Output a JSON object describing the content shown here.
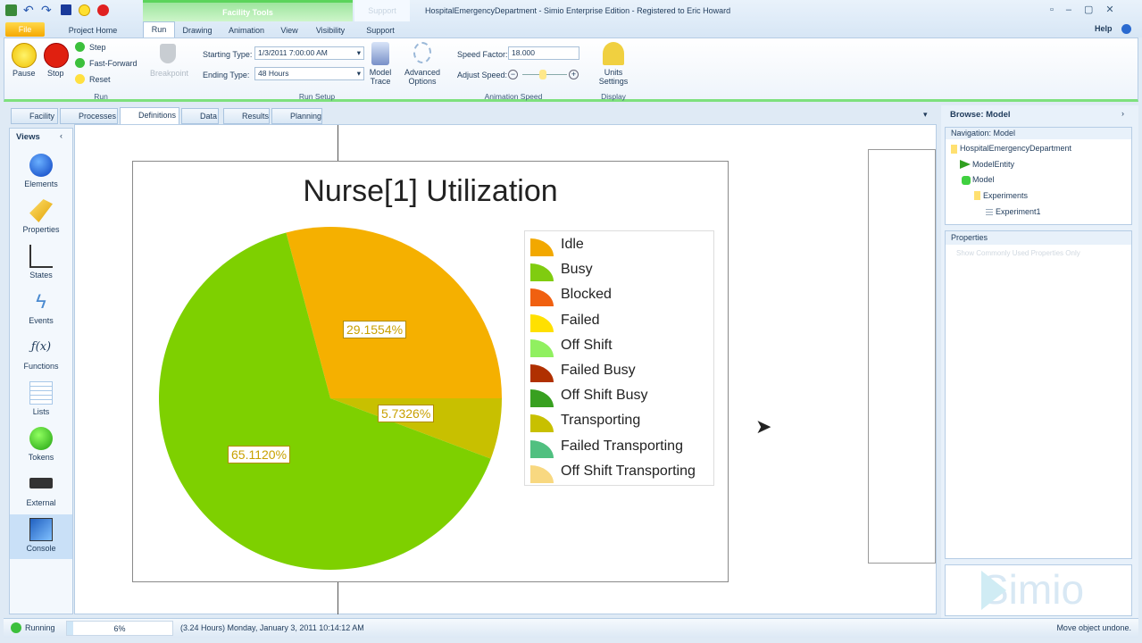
{
  "window": {
    "title": "HospitalEmergencyDepartment - Simio Enterprise Edition - Registered to Eric Howard",
    "context_tab": "Facility Tools",
    "context_tab2": "Support",
    "help": "Help"
  },
  "ribbon_tabs": [
    "File",
    "Project Home",
    "Run",
    "Drawing",
    "Animation",
    "View",
    "Visibility",
    "Support"
  ],
  "run_group": {
    "pause": "Pause",
    "stop": "Stop",
    "step": "Step",
    "fast_forward": "Fast-Forward",
    "reset": "Reset",
    "breakpoint": "Breakpoint",
    "label": "Run"
  },
  "run_setup": {
    "starting_type_label": "Starting Type:",
    "starting_type": "1/3/2011 7:00:00 AM",
    "ending_type_label": "Ending Type:",
    "ending_type": "48 Hours",
    "model_trace": "Model Trace",
    "advanced_options": "Advanced Options",
    "label": "Run Setup"
  },
  "animation_speed": {
    "speed_factor_label": "Speed Factor:",
    "speed_factor": "18.000",
    "adjust_speed_label": "Adjust Speed:",
    "label": "Animation Speed"
  },
  "display": {
    "units_settings": "Units Settings",
    "label": "Display"
  },
  "doc_tabs": [
    "Facility",
    "Processes",
    "Definitions",
    "Data",
    "Results",
    "Planning"
  ],
  "views": {
    "header": "Views",
    "items": [
      "Elements",
      "Properties",
      "States",
      "Events",
      "Functions",
      "Lists",
      "Tokens",
      "External",
      "Console"
    ]
  },
  "browse": {
    "title": "Browse: Model",
    "navigation": "Navigation: Model",
    "tree": [
      "HospitalEmergencyDepartment",
      "ModelEntity",
      "Model",
      "Experiments",
      "Experiment1"
    ],
    "properties": "Properties",
    "show_common": "Show Commonly Used Properties Only",
    "logo": "Simio"
  },
  "status": {
    "state": "Running",
    "progress_text": "6%",
    "progress": 0.06,
    "time": "(3.24 Hours) Monday, January 3, 2011 10:14:12 AM",
    "message": "Move object undone."
  },
  "chart_data": {
    "type": "pie",
    "title": "Nurse[1] Utilization",
    "slices": [
      {
        "name": "Idle",
        "value": 29.1554,
        "label": "29.1554%",
        "color": "#f5b000"
      },
      {
        "name": "Transporting",
        "value": 5.7326,
        "label": "5.7326%",
        "color": "#c8c000"
      },
      {
        "name": "Busy",
        "value": 65.112,
        "label": "65.1120%",
        "color": "#7ed000"
      }
    ],
    "legend": [
      {
        "name": "Idle",
        "color": "#f2a800"
      },
      {
        "name": "Busy",
        "color": "#80cc10"
      },
      {
        "name": "Blocked",
        "color": "#f06010"
      },
      {
        "name": "Failed",
        "color": "#ffe000"
      },
      {
        "name": "Off Shift",
        "color": "#90f060"
      },
      {
        "name": "Failed Busy",
        "color": "#b03000"
      },
      {
        "name": "Off Shift Busy",
        "color": "#38a020"
      },
      {
        "name": "Transporting",
        "color": "#c8c000"
      },
      {
        "name": "Failed Transporting",
        "color": "#50c080"
      },
      {
        "name": "Off Shift Transporting",
        "color": "#f8d880"
      }
    ],
    "legend_position": "right"
  }
}
